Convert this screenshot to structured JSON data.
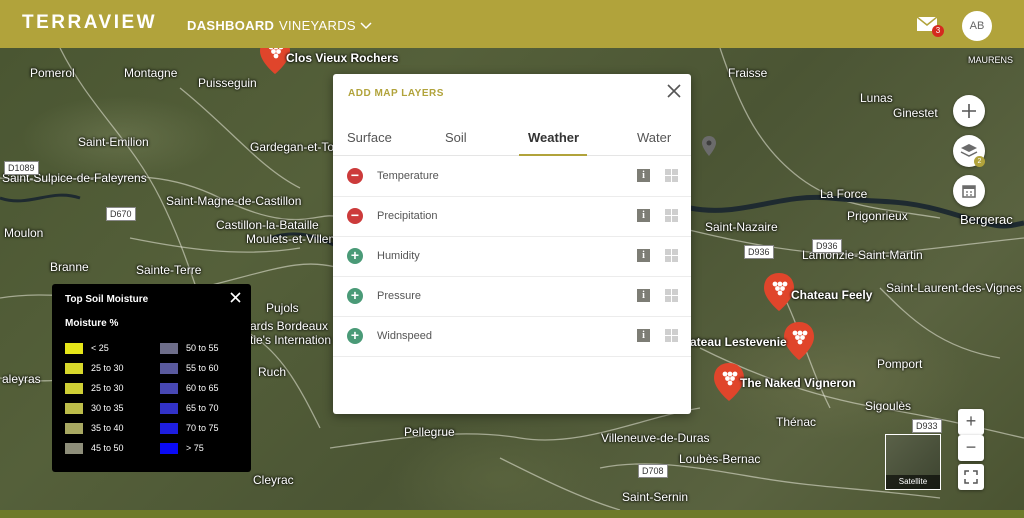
{
  "header": {
    "logo": "TERRAVIEW",
    "nav_dashboard": "DASHBOARD",
    "nav_vineyards": "VINEYARDS",
    "mail_count": "3",
    "avatar_initials": "AB",
    "bar_color": "#b1a33b"
  },
  "map": {
    "places": [
      "Pomerol",
      "Montagne",
      "Puisseguin",
      "Saint-Emilion",
      "Saint-Sulpice-de-Faleyrens",
      "Gardegan-et-Tourtirac",
      "Saint-Magne-de-Castillon",
      "Castillon-la-Bataille",
      "Moulets-et-Villemartin",
      "Moulon",
      "Branne",
      "Sainte-Terre",
      "Fraisse",
      "Lunas",
      "Ginestet",
      "MAURENS",
      "La Force",
      "Prigonrieux",
      "Bergerac",
      "Saint-Nazaire",
      "Lamonzie-Saint-Martin",
      "Saint-Laurent-des-Vignes",
      "Pujols",
      "ards Bordeaux",
      "tie's Internation",
      "Ruch",
      "aleyras",
      "Pomport",
      "Sigoulès",
      "Thénac",
      "Pellegrue",
      "Villeneuve-de-Duras",
      "Loubès-Bernac",
      "Saint-Sernin",
      "Cleyrac"
    ],
    "roads": [
      "D1089",
      "D670",
      "D936",
      "D936",
      "D933",
      "D708"
    ],
    "pins": [
      {
        "label": "Clos Vieux Rochers"
      },
      {
        "label": "Chateau Feely"
      },
      {
        "label": "ateau Lestevenie"
      },
      {
        "label": "The Naked Vigneron"
      }
    ],
    "layers_badge": "2",
    "satellite_label": "Satellite"
  },
  "modal": {
    "title": "ADD MAP LAYERS",
    "tabs": [
      {
        "label": "Surface"
      },
      {
        "label": "Soil"
      },
      {
        "label": "Weather"
      },
      {
        "label": "Water"
      }
    ],
    "active_tab": "Weather",
    "rows": [
      {
        "label": "Temperature",
        "state": "minus"
      },
      {
        "label": "Precipitation",
        "state": "minus"
      },
      {
        "label": "Humidity",
        "state": "plus"
      },
      {
        "label": "Pressure",
        "state": "plus"
      },
      {
        "label": "Widnspeed",
        "state": "plus"
      }
    ]
  },
  "legend": {
    "title": "Top Soil Moisture",
    "subtitle": "Moisture %",
    "items": [
      {
        "label": "< 25",
        "color": "#e6e619"
      },
      {
        "label": "25 to 30",
        "color": "#d8d82b"
      },
      {
        "label": "25 to 30",
        "color": "#cfcf35"
      },
      {
        "label": "30 to 35",
        "color": "#bdbd4a"
      },
      {
        "label": "35 to 40",
        "color": "#a8a862"
      },
      {
        "label": "45 to 50",
        "color": "#8e8e7a"
      },
      {
        "label": "50 to 55",
        "color": "#6e6e8a"
      },
      {
        "label": "55 to 60",
        "color": "#5a5a9e"
      },
      {
        "label": "60 to 65",
        "color": "#4848b4"
      },
      {
        "label": "65 to 70",
        "color": "#3232c8"
      },
      {
        "label": "70 to 75",
        "color": "#1e1ee0"
      },
      {
        "label": "> 75",
        "color": "#0a0af5"
      }
    ]
  }
}
